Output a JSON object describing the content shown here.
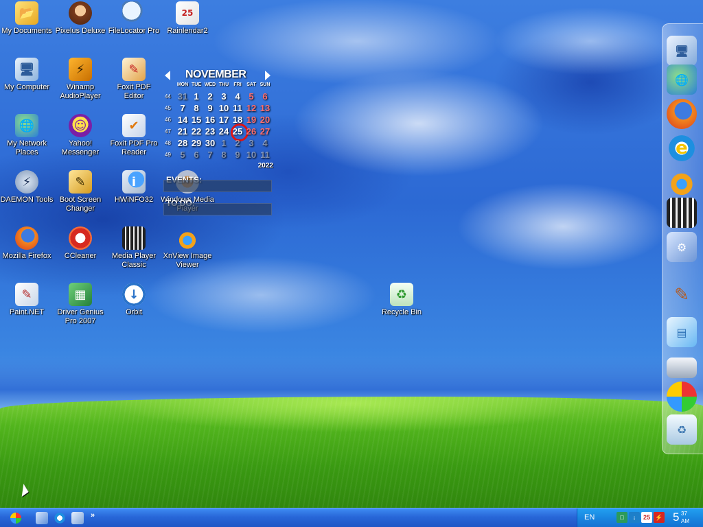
{
  "desktop": {
    "icons": [
      {
        "id": "my-documents",
        "label": "My Documents"
      },
      {
        "id": "pixelus-deluxe",
        "label": "Pixelus Deluxe"
      },
      {
        "id": "filelocator-pro",
        "label": "FileLocator Pro"
      },
      {
        "id": "rainlendar2",
        "label": "Rainlendar2"
      },
      {
        "id": "my-computer",
        "label": "My Computer"
      },
      {
        "id": "winamp",
        "label": "Winamp AudioPlayer"
      },
      {
        "id": "foxit-pdf-editor",
        "label": "Foxit PDF Editor"
      },
      {
        "id": "my-network-places",
        "label": "My Network Places"
      },
      {
        "id": "yahoo-messenger",
        "label": "Yahoo! Messenger"
      },
      {
        "id": "foxit-pdf-pro-reader",
        "label": "Foxit PDF Pro Reader"
      },
      {
        "id": "daemon-tools",
        "label": "DAEMON Tools"
      },
      {
        "id": "boot-screen-changer",
        "label": "Boot Screen Changer"
      },
      {
        "id": "hwinfo32",
        "label": "HWiNFO32"
      },
      {
        "id": "windows-media-player",
        "label": "Windows Media Player"
      },
      {
        "id": "mozilla-firefox",
        "label": "Mozilla Firefox"
      },
      {
        "id": "ccleaner",
        "label": "CCleaner"
      },
      {
        "id": "media-player-classic",
        "label": "Media Player Classic"
      },
      {
        "id": "xnview",
        "label": "XnView Image Viewer"
      },
      {
        "id": "paint-net",
        "label": "Paint.NET"
      },
      {
        "id": "driver-genius",
        "label": "Driver Genius Pro 2007"
      },
      {
        "id": "orbit",
        "label": "Orbit"
      },
      {
        "id": "recycle-bin",
        "label": "Recycle Bin"
      }
    ]
  },
  "calendar": {
    "month": "NOVEMBER",
    "year": "2022",
    "weekdays": [
      "MON",
      "TUE",
      "WED",
      "THU",
      "FRI",
      "SAT",
      "SUN"
    ],
    "weeks": [
      {
        "num": "44",
        "days": [
          "31",
          "1",
          "2",
          "3",
          "4",
          "5",
          "6"
        ]
      },
      {
        "num": "45",
        "days": [
          "7",
          "8",
          "9",
          "10",
          "11",
          "12",
          "13"
        ]
      },
      {
        "num": "46",
        "days": [
          "14",
          "15",
          "16",
          "17",
          "18",
          "19",
          "20"
        ]
      },
      {
        "num": "47",
        "days": [
          "21",
          "22",
          "23",
          "24",
          "25",
          "26",
          "27"
        ]
      },
      {
        "num": "48",
        "days": [
          "28",
          "29",
          "30",
          "1",
          "2",
          "3",
          "4"
        ]
      },
      {
        "num": "49",
        "days": [
          "5",
          "6",
          "7",
          "8",
          "9",
          "10",
          "11"
        ]
      }
    ],
    "today": "25",
    "events_title": "EVENTS:",
    "todo_title": "TO DO:"
  },
  "dock": {
    "items": [
      "my-computer-icon",
      "network-icon",
      "firefox-icon",
      "internet-explorer-icon",
      "xnview-icon",
      "media-player-classic-icon",
      "control-panel-icon",
      "paint-icon",
      "notepad-icon",
      "drive-icon",
      "windows-update-icon",
      "recycle-bin-icon"
    ]
  },
  "taskbar": {
    "language": "EN",
    "quicklaunch_more": "»",
    "tray_calendar_day": "25",
    "clock": {
      "hour": "5",
      "minute": "37",
      "ampm": "AM"
    }
  }
}
